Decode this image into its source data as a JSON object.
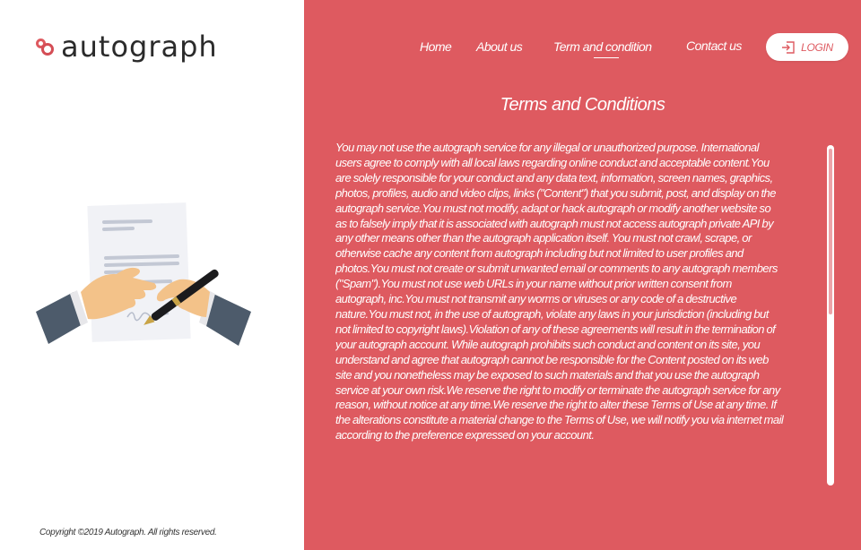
{
  "brand": {
    "name": "autograph",
    "accent": "#de5a60"
  },
  "nav": {
    "items": [
      {
        "label": "Home"
      },
      {
        "label": "About us"
      },
      {
        "label": "Term and condition",
        "active": true
      },
      {
        "label": "Contact us"
      }
    ],
    "login_label": "LOGIN"
  },
  "icons": {
    "login": "login-icon",
    "illustration": "signing-document-illustration",
    "logo": "autograph-logo-icon"
  },
  "main": {
    "title": "Terms and Conditions",
    "body": "You may not use the autograph service for any illegal or unauthorized purpose. International users agree to comply with all local laws regarding online conduct and acceptable content.You are solely responsible for your conduct and any data text, information, screen names, graphics, photos, profiles, audio and video clips, links (\"Content\") that you submit, post, and display on the autograph service.You must not modify, adapt or hack autograph or modify another website so as to falsely imply that it is associated with autograph must not access autograph private API by any other means other than the autograph application itself. You must not crawl, scrape, or otherwise cache any content from autograph including but not limited to user profiles and photos.You must not create or submit unwanted email or comments to any autograph members (\"Spam\").You must not use web URLs in your name without prior written consent from autograph, inc.You must not transmit any worms or viruses or any code of a destructive nature.You must not, in the use of autograph, violate any laws in your jurisdiction (including but not limited to copyright laws).Violation of any of these agreements will result in the termination of your autograph account. While autograph prohibits such conduct and content on its site, you understand and agree that autograph cannot be responsible for the Content posted on its web site and you nonetheless may be exposed to such materials and that you use the autograph service at your own risk.We reserve the right to modify or terminate the autograph service for any reason, without notice at any time.We reserve the right to alter these Terms of Use at any time. If the alterations constitute a material change to the Terms of Use, we will notify you via internet mail according to the preference expressed on your account."
  },
  "footer": {
    "copyright": "Copyright ©2019 Autograph. All rights reserved."
  }
}
